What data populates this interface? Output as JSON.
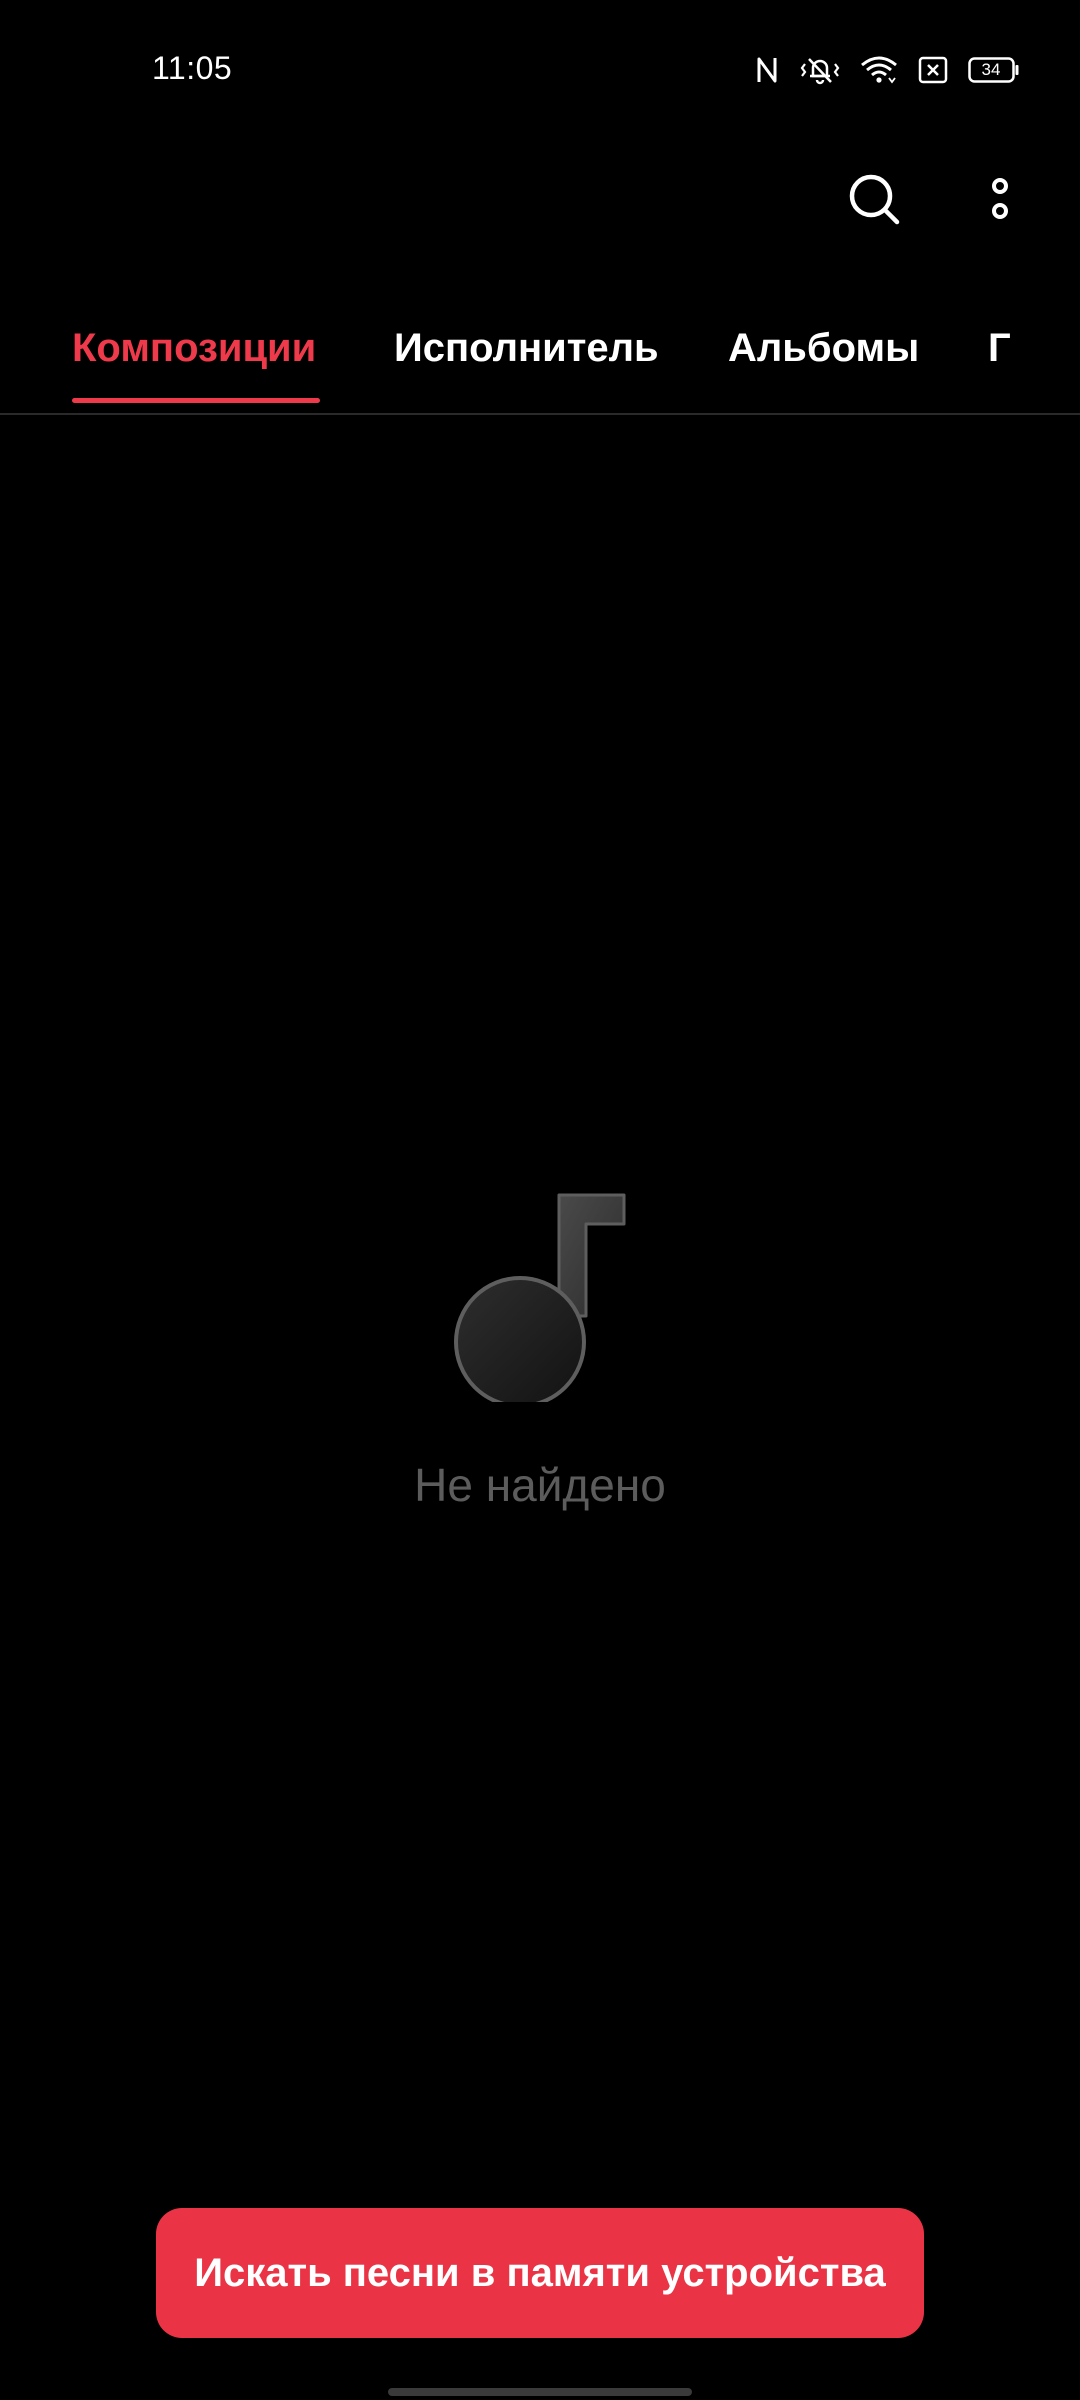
{
  "status_bar": {
    "time": "11:05",
    "battery_level": "34",
    "icons": [
      "nfc-icon",
      "vibrate-silent-icon",
      "wifi-icon",
      "no-sim-icon",
      "battery-icon"
    ]
  },
  "app_bar": {
    "icons": [
      "search-icon",
      "more-vertical-icon"
    ]
  },
  "tabs": {
    "items": [
      {
        "label": "Композиции",
        "active": true
      },
      {
        "label": "Исполнитель",
        "active": false
      },
      {
        "label": "Альбомы",
        "active": false
      },
      {
        "label": "Г",
        "active": false
      }
    ]
  },
  "empty_state": {
    "icon": "music-note-icon",
    "message": "Не найдено"
  },
  "scan_button": {
    "label": "Искать песни в памяти устройства"
  },
  "colors": {
    "accent": "#ef3a4b",
    "button": "#ea3446",
    "background": "#000000",
    "empty_text": "#5c5c5c"
  }
}
